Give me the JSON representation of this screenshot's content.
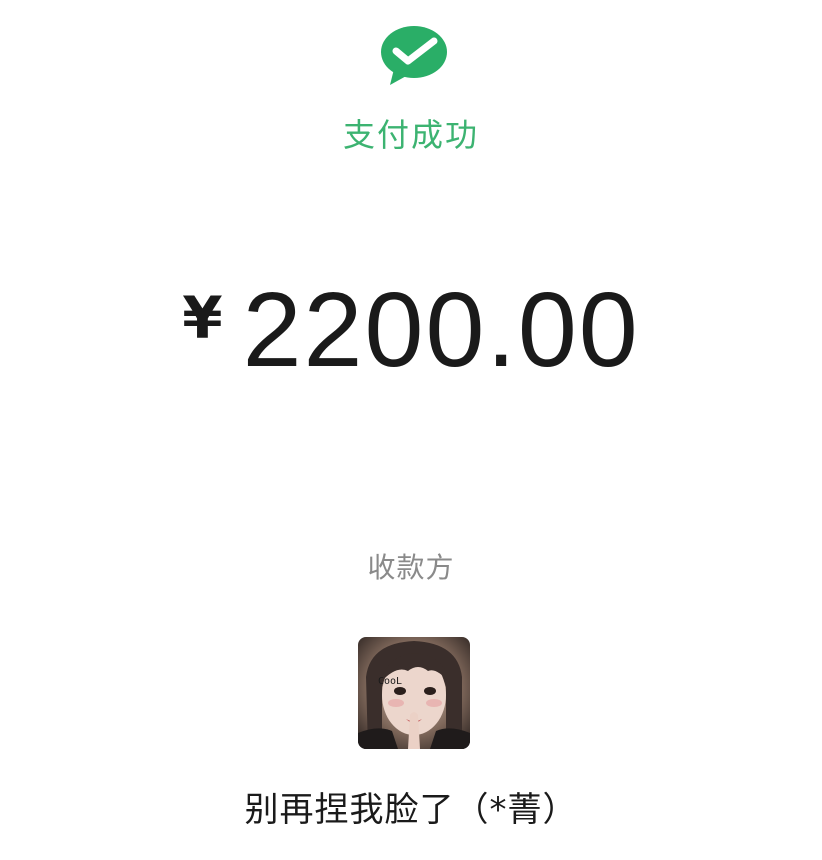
{
  "payment": {
    "status_icon": "wechat-pay-check-icon",
    "status_text": "支付成功",
    "currency_symbol": "¥",
    "amount": "2200.00",
    "accent_color": "#3cb371"
  },
  "payee": {
    "label": "收款方",
    "avatar_icon": "profile-photo",
    "avatar_overlay_text": "CooL",
    "name": "别再捏我脸了（*菁）"
  }
}
